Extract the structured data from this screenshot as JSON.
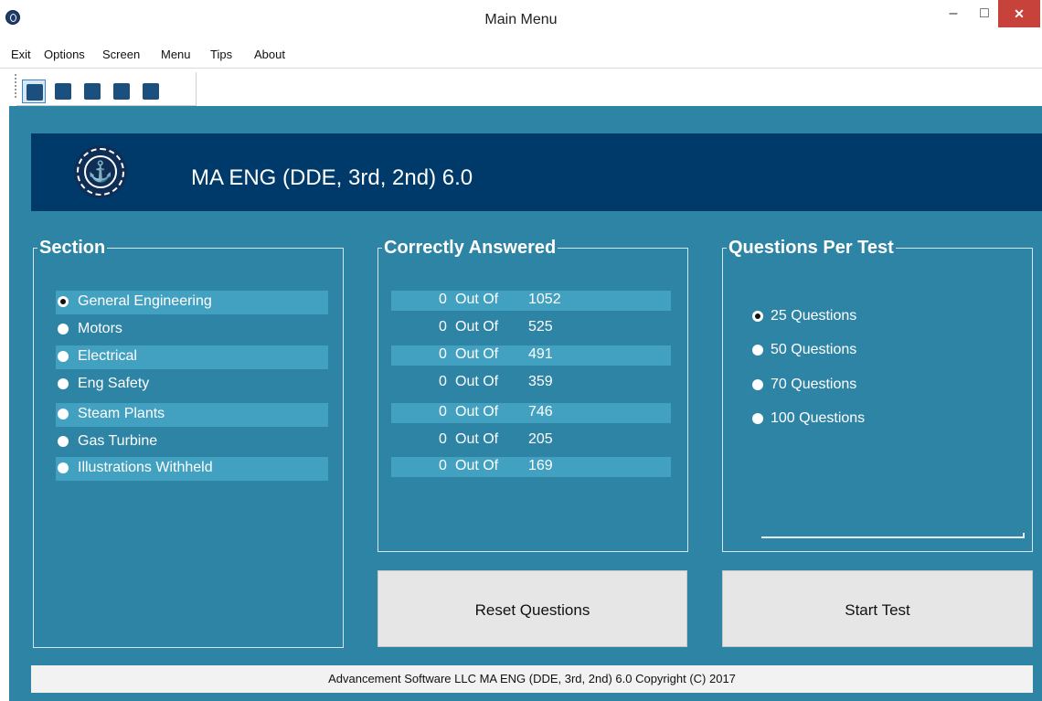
{
  "window": {
    "title": "Main Menu",
    "minimize": "–",
    "maximize": "□",
    "close": "✕"
  },
  "menu": [
    "Exit",
    "Options",
    "Screen",
    "Menu",
    "Tips",
    "About"
  ],
  "toolbar": [
    "grid-view-icon",
    "new-page-icon",
    "search-icon",
    "image-icon",
    "list-icon"
  ],
  "app_title": "MA ENG (DDE, 3rd, 2nd) 6.0",
  "section": {
    "legend": "Section",
    "items": [
      {
        "label": "General Engineering",
        "selected": true
      },
      {
        "label": "Motors",
        "selected": false
      },
      {
        "label": "Electrical",
        "selected": false
      },
      {
        "label": "Eng Safety",
        "selected": false
      },
      {
        "label": "Steam Plants",
        "selected": false
      },
      {
        "label": "Gas Turbine",
        "selected": false
      },
      {
        "label": "Illustrations Withheld",
        "selected": false
      }
    ]
  },
  "correct": {
    "legend": "Correctly Answered",
    "sep": "Out Of",
    "rows": [
      {
        "score": "0",
        "total": "1052"
      },
      {
        "score": "0",
        "total": "525"
      },
      {
        "score": "0",
        "total": "491"
      },
      {
        "score": "0",
        "total": "359"
      },
      {
        "score": "0",
        "total": "746"
      },
      {
        "score": "0",
        "total": "205"
      },
      {
        "score": "0",
        "total": "169"
      }
    ]
  },
  "questions": {
    "legend": "Questions Per Test",
    "options": [
      {
        "label": "25 Questions",
        "selected": true
      },
      {
        "label": "50 Questions",
        "selected": false
      },
      {
        "label": "70 Questions",
        "selected": false
      },
      {
        "label": "100 Questions",
        "selected": false
      }
    ]
  },
  "buttons": {
    "reset": "Reset Questions",
    "start": "Start Test"
  },
  "footer": "Advancement Software LLC MA ENG (DDE, 3rd, 2nd) 6.0 Copyright (C) 2017",
  "colors": {
    "panel": "#2e84a5",
    "banner": "#003a6a",
    "stripe": "#42a1c0"
  }
}
